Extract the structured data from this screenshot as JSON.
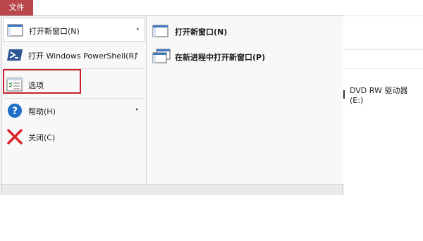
{
  "tab": {
    "file_label": "文件"
  },
  "background": {
    "drive_label": "DVD RW 驱动器 (E:)"
  },
  "menu": {
    "items": [
      {
        "label": "打开新窗口(N)",
        "icon": "window-icon",
        "has_submenu": true
      },
      {
        "label": "打开 Windows PowerShell(R)",
        "icon": "powershell-icon",
        "has_submenu": true
      },
      {
        "label": "选项",
        "icon": "options-icon",
        "has_submenu": false
      },
      {
        "label": "帮助(H)",
        "icon": "help-icon",
        "has_submenu": true
      },
      {
        "label": "关闭(C)",
        "icon": "close-icon",
        "has_submenu": false
      }
    ],
    "submenu": [
      {
        "label": "打开新窗口(N)",
        "icon": "window-icon"
      },
      {
        "label": "在新进程中打开新窗口(P)",
        "icon": "multi-window-icon"
      }
    ],
    "arrow_glyph": "▸"
  },
  "colors": {
    "file_tab": "#b9474c",
    "highlight_border": "#c8232c",
    "help_blue": "#1e6fc8",
    "close_red": "#d9232c"
  }
}
